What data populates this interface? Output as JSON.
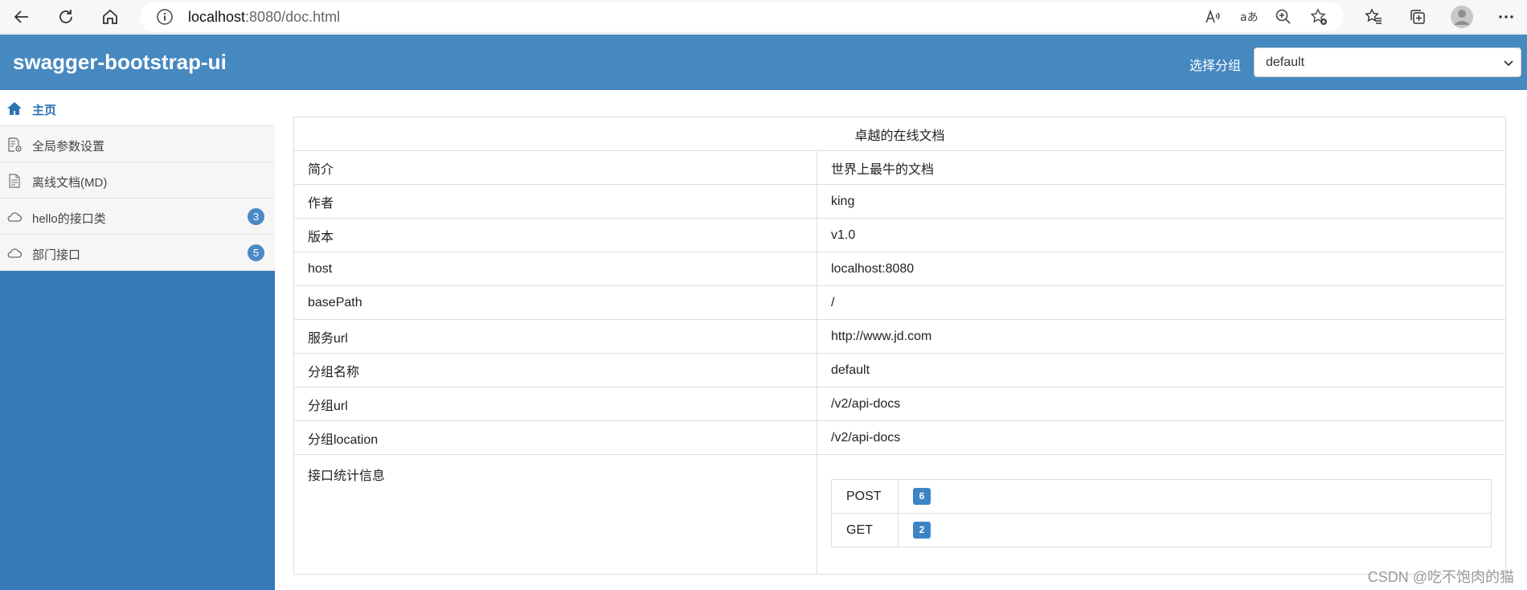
{
  "browser": {
    "url_host": "localhost",
    "url_rest": ":8080/doc.html",
    "icons": [
      "back-icon",
      "refresh-icon",
      "home-icon",
      "info-icon",
      "read-aloud-icon",
      "translate-icon",
      "zoom-icon",
      "add-favorite-icon",
      "favorites-icon",
      "collections-icon",
      "profile-icon",
      "more-icon"
    ]
  },
  "header": {
    "title": "swagger-bootstrap-ui",
    "group_label": "选择分组",
    "group_value": "default",
    "bg_color": "#4688c0"
  },
  "sidebar": {
    "items": [
      {
        "label": "主页",
        "icon": "home-icon",
        "badge": ""
      },
      {
        "label": "全局参数设置",
        "icon": "settings-doc-icon",
        "badge": ""
      },
      {
        "label": "离线文档(MD)",
        "icon": "document-icon",
        "badge": ""
      },
      {
        "label": "hello的接口类",
        "icon": "cloud-icon",
        "badge": "3"
      },
      {
        "label": "部门接口",
        "icon": "cloud-icon",
        "badge": "5"
      }
    ]
  },
  "doc": {
    "title": "卓越的在线文档",
    "rows": [
      {
        "key": "简介",
        "value": "世界上最牛的文档"
      },
      {
        "key": "作者",
        "value": "king"
      },
      {
        "key": "版本",
        "value": "v1.0"
      },
      {
        "key": "host",
        "value": "localhost:8080"
      },
      {
        "key": "basePath",
        "value": "/"
      },
      {
        "key": "服务url",
        "value": "http://www.jd.com"
      },
      {
        "key": "分组名称",
        "value": "default"
      },
      {
        "key": "分组url",
        "value": "/v2/api-docs"
      },
      {
        "key": "分组location",
        "value": "/v2/api-docs"
      }
    ],
    "stats_label": "接口统计信息",
    "stats": [
      {
        "method": "POST",
        "count": "6"
      },
      {
        "method": "GET",
        "count": "2"
      }
    ]
  },
  "watermark": "CSDN @吃不饱肉的猫"
}
